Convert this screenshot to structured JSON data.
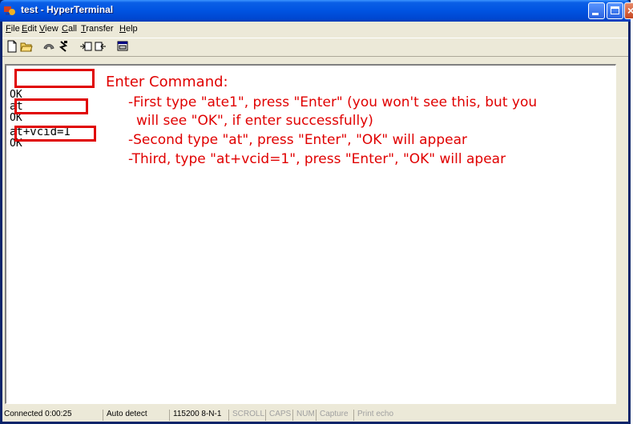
{
  "window": {
    "title": "test - HyperTerminal"
  },
  "menu": {
    "items": [
      {
        "label": "File",
        "u": "F",
        "rest": "ile"
      },
      {
        "label": "Edit",
        "u": "E",
        "rest": "dit"
      },
      {
        "label": "View",
        "u": "V",
        "rest": "iew"
      },
      {
        "label": "Call",
        "u": "C",
        "rest": "all"
      },
      {
        "label": "Transfer",
        "u": "T",
        "rest": "ransfer"
      },
      {
        "label": "Help",
        "u": "H",
        "rest": "elp"
      }
    ]
  },
  "toolbar": {
    "icons": [
      "new-icon",
      "open-icon",
      "connect-icon",
      "disconnect-icon",
      "send-icon",
      "receive-icon",
      "properties-icon"
    ]
  },
  "terminal": {
    "lines": [
      "OK",
      "at",
      "OK",
      "at+vcid=1",
      "OK"
    ]
  },
  "annotation": {
    "heading": "Enter Command:",
    "step1a": "-First type \"ate1\", press \"Enter\" (you won't see this, but you",
    "step1b": "will see \"OK\", if enter successfully)",
    "step2": "-Second type \"at\", press \"Enter\", \"OK\" will appear",
    "step3": "-Third, type \"at+vcid=1\", press \"Enter\", \"OK\" will apear"
  },
  "status": {
    "connected": "Connected 0:00:25",
    "detect": "Auto detect",
    "port": "115200 8-N-1",
    "scroll": "SCROLL",
    "caps": "CAPS",
    "num": "NUM",
    "capture": "Capture",
    "echo": "Print echo"
  },
  "colors": {
    "annotation": "#e00000",
    "title_bar": "#0053e1"
  }
}
